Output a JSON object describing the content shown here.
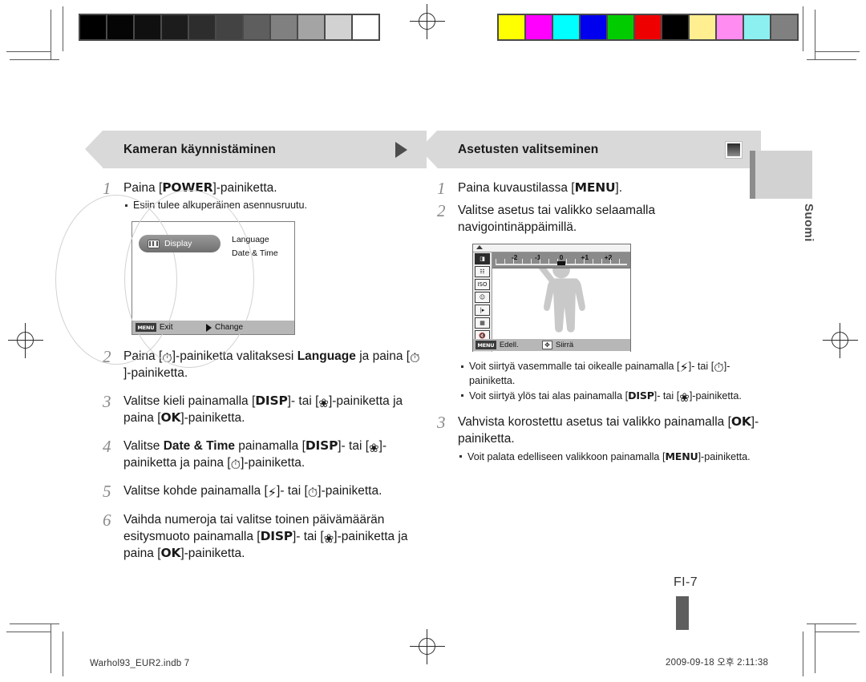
{
  "document": {
    "language_tab": "Suomi",
    "page_number": "FI-7",
    "footer_left": "Warhol93_EUR2.indb   7",
    "footer_right": "2009-09-18   오후 2:11:38"
  },
  "calibration": {
    "grayscale_label": "grayscale-calibration-bar",
    "grayscale_swatches": [
      "#000000",
      "#050505",
      "#101010",
      "#1c1c1c",
      "#2d2d2d",
      "#434343",
      "#5e5e5e",
      "#808080",
      "#a4a4a4",
      "#d2d2d2",
      "#ffffff"
    ],
    "color_label": "color-calibration-bar",
    "color_swatches": [
      "#ffff00",
      "#ff00ff",
      "#00ffff",
      "#0000ee",
      "#00cc00",
      "#ee0000",
      "#000000",
      "#ffef90",
      "#ff8cf0",
      "#8cf0f0",
      "#808080"
    ]
  },
  "left_column": {
    "header": "Kameran käynnistäminen",
    "header_glyph": "triangle-right-icon",
    "steps": [
      {
        "number": "1",
        "text_before": "Paina [",
        "key": "POWER",
        "text_after": "]-painiketta.",
        "bullets": [
          "Esiin tulee alkuperäinen asennusruutu."
        ]
      }
    ],
    "lcd_settings": {
      "menu_item": "Display",
      "options": [
        "Language",
        "Date & Time"
      ],
      "bottom_left_tag": "MENU",
      "bottom_left_label": "Exit",
      "bottom_right_label": "Change"
    },
    "steps_after": [
      {
        "number": "2",
        "html": "Paina [<span class=\"gi gi-timer\">&#x23F1;</span>]-painiketta valitaksesi <b>Language</b> ja paina [<span class=\"gi gi-timer\">&#x23F1;</span>]-painiketta."
      },
      {
        "number": "3",
        "html": "Valitse kieli painamalla [<span class=\"kb\">DISP</span>]- tai [<span class=\"gi gi-macro\">&#x2740;</span>]-painiketta ja paina [<span class=\"kb\">OK</span>]-painiketta."
      },
      {
        "number": "4",
        "html": "Valitse <b>Date &amp; Time</b> painamalla [<span class=\"kb\">DISP</span>]- tai [<span class=\"gi gi-macro\">&#x2740;</span>]-painiketta ja paina [<span class=\"gi gi-timer\">&#x23F1;</span>]-painiketta."
      },
      {
        "number": "5",
        "html": "Valitse kohde painamalla [<span class=\"gi gi-flash\">&#x26A1;</span>]- tai [<span class=\"gi gi-timer\">&#x23F1;</span>]-painiketta."
      },
      {
        "number": "6",
        "html": "Vaihda numeroja tai valitse toinen päivämäärän esitysmuoto painamalla [<span class=\"kb\">DISP</span>]- tai [<span class=\"gi gi-macro\">&#x2740;</span>]-painiketta ja paina [<span class=\"kb\">OK</span>]-painiketta."
      }
    ]
  },
  "right_column": {
    "header": "Asetusten valitseminen",
    "header_glyph": "square-dark-icon",
    "steps_before": [
      {
        "number": "1",
        "html": "Paina kuvaustilassa [<span class=\"kb\">MENU</span>]."
      },
      {
        "number": "2",
        "html": "Valitse asetus tai valikko selaamalla navigointinäppäimillä."
      }
    ],
    "lcd_ev": {
      "scale_labels": [
        "-2",
        "-1",
        "0",
        "+1",
        "+2"
      ],
      "selected_value": "0",
      "row_label": "EV",
      "bottom_left_tag": "MENU",
      "bottom_left_label": "Edell.",
      "bottom_right_label": "Siirrä",
      "sidebar_icons": [
        "ev-icon",
        "white-balance-icon",
        "iso-icon",
        "face-detect-off-icon",
        "focus-area-icon",
        "image-quality-icon",
        "voice-off-icon"
      ]
    },
    "bullets_after_lcd": [
      "Voit siirtyä vasemmalle tai oikealle painamalla [⚡]- tai [⏱]-painiketta.",
      "Voit siirtyä ylös tai alas painamalla [DISP]- tai [❀]-painiketta."
    ],
    "step3": {
      "number": "3",
      "html": "Vahvista korostettu asetus tai valikko painamalla [<span class=\"kb\">OK</span>]-painiketta.",
      "bullets_html": [
        "Voit palata edelliseen valikkoon painamalla [<span class=\"kb\">MENU</span>]-painiketta."
      ]
    }
  }
}
